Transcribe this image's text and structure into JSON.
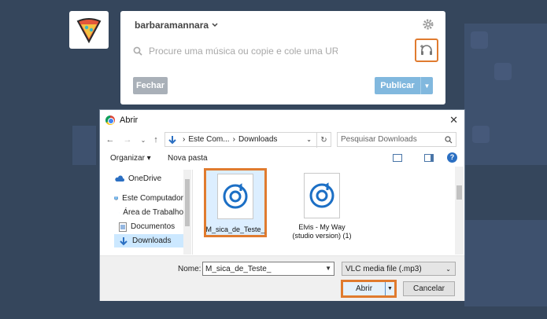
{
  "colors": {
    "accent": "#e07b2f",
    "publish": "#81b8de",
    "background": "#35465c"
  },
  "post": {
    "username": "barbaramannara",
    "search_placeholder": "Procure uma música ou copie e cole uma URL",
    "close_label": "Fechar",
    "publish_label": "Publicar"
  },
  "dialog": {
    "title": "Abrir",
    "close_glyph": "✕",
    "breadcrumb": [
      "Este Com...",
      "Downloads"
    ],
    "search_placeholder": "Pesquisar Downloads",
    "organize_label": "Organizar ▾",
    "new_folder_label": "Nova pasta",
    "nav_items": [
      {
        "label": "OneDrive",
        "icon": "cloud-icon"
      },
      {
        "label": "Este Computador",
        "icon": "computer-icon"
      },
      {
        "label": "Área de Trabalho",
        "icon": "desktop-icon"
      },
      {
        "label": "Documentos",
        "icon": "documents-icon"
      },
      {
        "label": "Downloads",
        "icon": "downloads-icon"
      }
    ],
    "files": [
      {
        "name": "M_sica_de_Teste_",
        "icon": "vlc-audio-icon"
      },
      {
        "name": "Elvis - My Way (studio version) (1)",
        "icon": "vlc-audio-icon"
      }
    ],
    "name_label": "Nome:",
    "name_value": "M_sica_de_Teste_",
    "file_type": "VLC media file (.mp3)",
    "open_label": "Abrir",
    "cancel_label": "Cancelar"
  }
}
